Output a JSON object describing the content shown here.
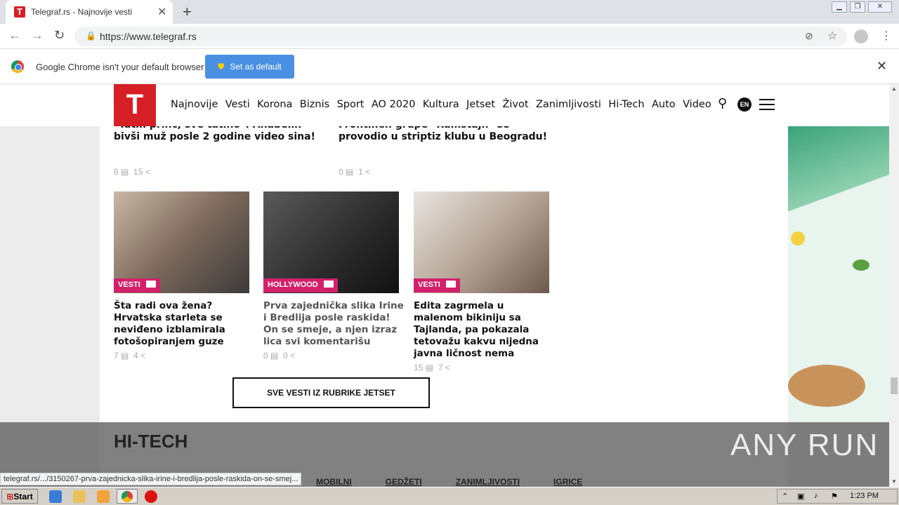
{
  "browser": {
    "tab_title": "Telegraf.rs - Najnovije vesti",
    "url": "https://www.telegraf.rs",
    "infobar_text": "Google Chrome isn't your default browser",
    "set_default_label": "Set as default"
  },
  "site": {
    "logo": "T",
    "menu": [
      "Najnovije",
      "Vesti",
      "Korona",
      "Biznis",
      "Sport",
      "AO 2020",
      "Kultura",
      "Jetset",
      "Život",
      "Zanimljivosti",
      "Hi-Tech",
      "Auto",
      "Video"
    ],
    "lang_badge": "EN"
  },
  "top_articles": [
    {
      "title_line1": "\"Tatin princ, sve tatino\": Anabelin",
      "title_line2": "bivši muž posle 2 godine video sina!",
      "comments": "6",
      "shares": "15"
    },
    {
      "title_line1": "Frontmen grupe \"Ramštajn\" se",
      "title_line2": "provodio u striptiz klubu u Beogradu!",
      "comments": "0",
      "shares": "1"
    }
  ],
  "cards": [
    {
      "tag": "VESTI",
      "title": "Šta radi ova žena? Hrvatska starleta se neviđeno izblamirala fotošopiranjem guze",
      "comments": "7",
      "shares": "4"
    },
    {
      "tag": "HOLLYWOOD",
      "title": "Prva zajednička slika Irine i Bredlija posle raskida! On se smeje, a njen izraz lica svi komentarišu",
      "comments": "0",
      "shares": "0"
    },
    {
      "tag": "VESTI",
      "title": "Edita zagrmela u malenom bikiniju sa Tajlanda, pa pokazala tetovažu kakvu nijedna javna ličnost nema",
      "comments": "15",
      "shares": "7"
    }
  ],
  "rubrika_button": "SVE VESTI IZ RUBRIKE JETSET",
  "section_title": "HI-TECH",
  "subnav": [
    "MOBILNI",
    "GEDŽETI",
    "ZANIMLJIVOSTI",
    "IGRICE"
  ],
  "watermark": "ANY RUN",
  "status_url": "telegraf.rs/.../3150267-prva-zajednicka-slika-irine-i-bredlija-posle-raskida-on-se-smej...",
  "taskbar": {
    "start": "Start",
    "clock": "1:23 PM"
  }
}
